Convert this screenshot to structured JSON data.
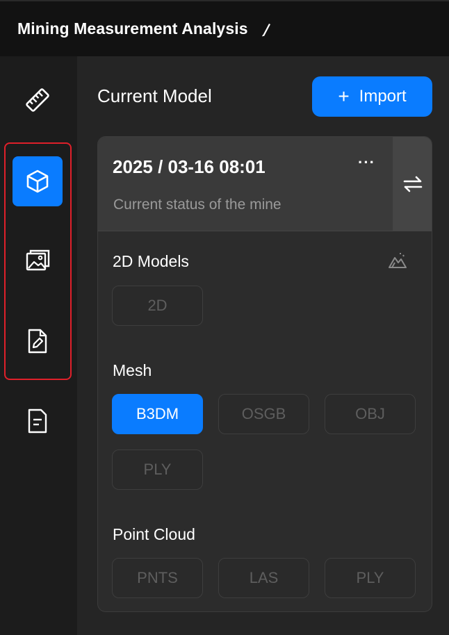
{
  "header": {
    "title": "Mining Measurement Analysis",
    "edit_icon": "pencil-icon"
  },
  "sidebar": {
    "items": [
      {
        "name": "measure",
        "icon": "ruler-icon",
        "active": false
      },
      {
        "name": "model",
        "icon": "cube-icon",
        "active": true
      },
      {
        "name": "images",
        "icon": "gallery-icon",
        "active": false
      },
      {
        "name": "edit-document",
        "icon": "document-edit-icon",
        "active": false
      },
      {
        "name": "report",
        "icon": "document-icon",
        "active": false
      }
    ]
  },
  "main": {
    "title": "Current Model",
    "import_label": "Import",
    "card": {
      "timestamp": "2025 / 03-16 08:01",
      "more_label": "···",
      "subtitle": "Current status of the mine",
      "sections": {
        "models_2d": {
          "title": "2D Models",
          "chips": [
            "2D"
          ]
        },
        "mesh": {
          "title": "Mesh",
          "chips": [
            "B3DM",
            "OSGB",
            "OBJ",
            "PLY"
          ],
          "active": "B3DM"
        },
        "point_cloud": {
          "title": "Point Cloud",
          "chips": [
            "PNTS",
            "LAS",
            "PLY"
          ]
        }
      }
    }
  },
  "colors": {
    "accent": "#0a7cff",
    "highlight": "#e0202a",
    "background": "#252525"
  }
}
